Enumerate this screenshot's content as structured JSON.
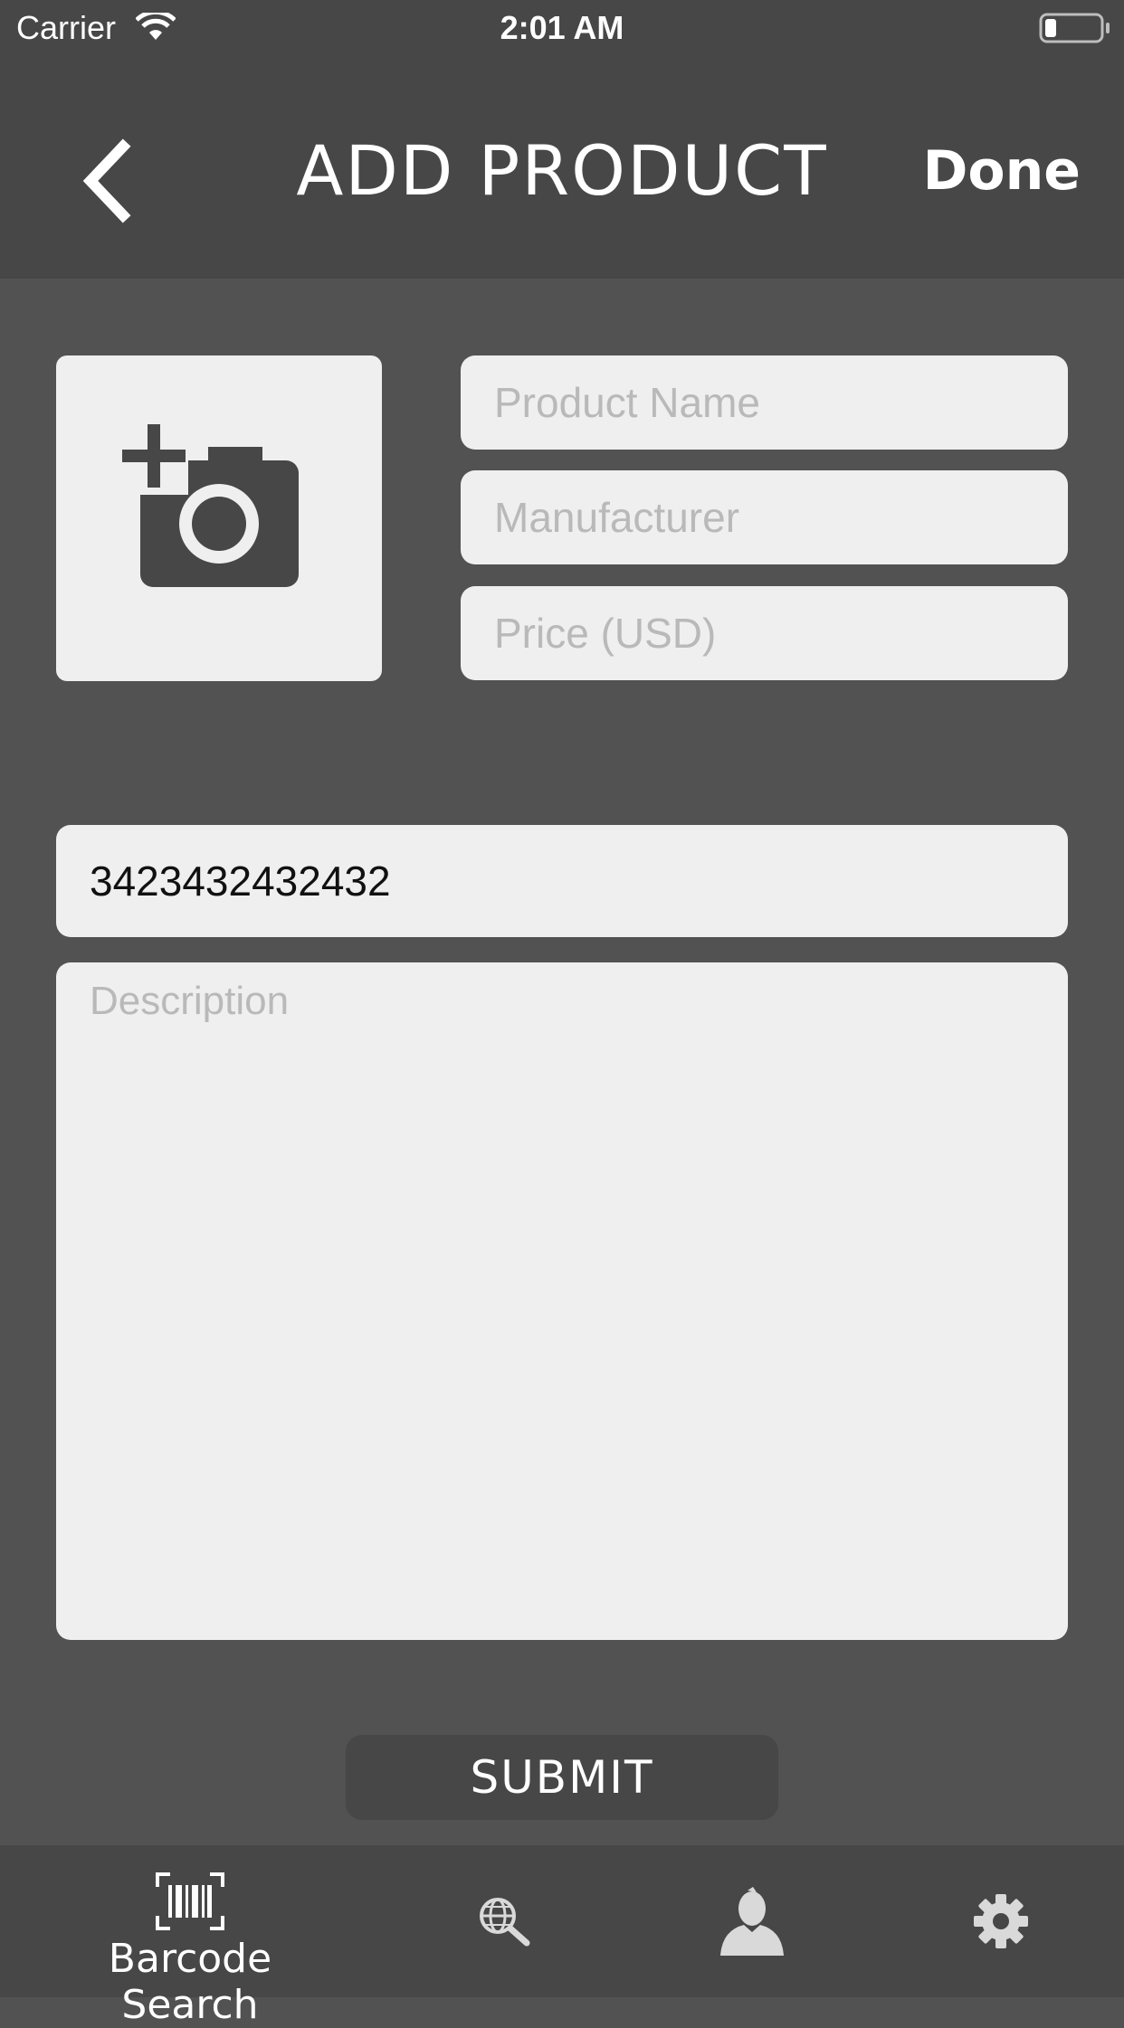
{
  "status_bar": {
    "carrier": "Carrier",
    "time": "2:01 AM",
    "icons": [
      "wifi-icon",
      "battery-icon"
    ]
  },
  "nav_bar": {
    "title": "ADD PRODUCT",
    "done_label": "Done",
    "back_icon": "chevron-left-icon"
  },
  "form": {
    "photo_icon": "add-photo-camera-icon",
    "product_name_placeholder": "Product Name",
    "manufacturer_placeholder": "Manufacturer",
    "price_placeholder": "Price (USD)",
    "barcode_value": "3423432432432",
    "description_placeholder": "Description",
    "submit_label": "SUBMIT"
  },
  "tab_bar": {
    "items": [
      {
        "label": "Barcode Search",
        "icon": "barcode-scan-icon"
      },
      {
        "label": "",
        "icon": "web-search-icon"
      },
      {
        "label": "",
        "icon": "profile-icon"
      },
      {
        "label": "",
        "icon": "gear-icon"
      }
    ]
  },
  "colors": {
    "background": "#525252",
    "bars": "#474747",
    "field": "#efefef",
    "placeholder": "#b9b9b9"
  }
}
